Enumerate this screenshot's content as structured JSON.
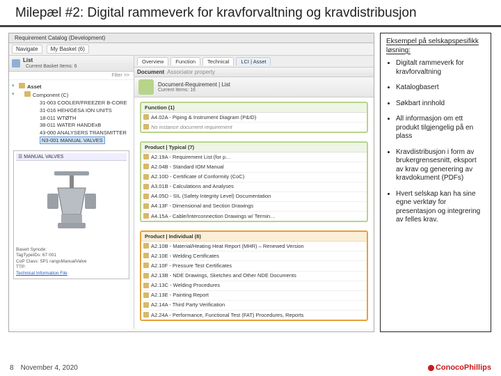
{
  "title": "Milepæl #2: Digital rammeverk for kravforvaltning og kravdistribusjon",
  "app": {
    "window_title": "Requirement Catalog (Development)",
    "nav1": "Navigate",
    "nav2": "My Basket (6)",
    "tab_overview": "Overview",
    "tab_function": "Function",
    "tab_technical": "Technical",
    "tab_asset": "LCI | Asset",
    "list_title": "List",
    "list_sub": "Current Basket Items: 6",
    "filter": "Filter >>",
    "tree_root": "Asset",
    "tree_comp": "Component (C)",
    "tree_items": [
      "31-003 COOLER/FREEZER B-CORE",
      "31-016 HEH/GESA ION UNITS",
      "18-011 WTØTH",
      "38-011 WATER HANDExB",
      "43-000 ANALYSERS TRANSMITTER",
      "N3-001 MANUAL VALVES"
    ],
    "preview_title": "MANUAL VALVES",
    "preview_meta1": "Basert Syncde:",
    "preview_meta2": "TagTypeIDs:   67 001",
    "preview_meta3": "CoP Class:   SP1 rangsManualValve",
    "preview_meta4": "TTP:",
    "preview_link": "Technical Information File",
    "doc_tab": "Document",
    "doc_sub": "Associator property",
    "doc_title": "Document-Requirement | List",
    "doc_sub2": "Current Items: 16",
    "grp1_head": "Function (1)",
    "grp1_a": "A4.02A - Piping & Instrument Diagram (P&ID)",
    "grp1_b": "No instance document requirement",
    "grp2_head": "Product | Typical (7)",
    "grp2_items": [
      "A2.19A - Requirement List (for p…",
      "A2.04B - Standard IOM Manual",
      "A2.10D - Certificate of Conformity (CoC)",
      "A3.01B - Calculations and Analyses",
      "A4.05D - SIL (Safety Integrity Level) Documentation",
      "A4.13F - Dimensional and Section Drawings",
      "A4.15A - Cable/Interconnection Drawings w/ Termin…"
    ],
    "grp3_head": "Product | Individual (8)",
    "grp3_items": [
      "A2.10B - Material/Heating Heat Report (MHR) – Renewed Version",
      "A2.10E - Welding Certificates",
      "A2.10F - Pressure Test Certificates",
      "A2.13B - NDE Drawings, Sketches and Other NDE Documents",
      "A2.13C - Welding Procedures",
      "A2.13E - Painting Report",
      "A2.14A - Third Party Verification",
      "A2.24A - Performance, Functional Test (FAT) Procedures, Reports"
    ]
  },
  "side": {
    "lead": "Eksempel på selskapspesifikk løsning:",
    "b1": "Digitalt rammeverk for kravforvaltning",
    "b2": "Katalogbasert",
    "b3": "Søkbart innhold",
    "b4": "All informasjon om ett produkt tilgjengelig på en plass",
    "b5": "Kravdistribusjon i form av brukergrensesnitt, eksport av krav og generering av kravdokument (PDFs)",
    "b6": "Hvert selskap kan ha sine egne verktøy for presentasjon og integrering av felles krav."
  },
  "footer": {
    "page": "8",
    "date": "November 4, 2020",
    "brand": "ConocoPhillips"
  }
}
